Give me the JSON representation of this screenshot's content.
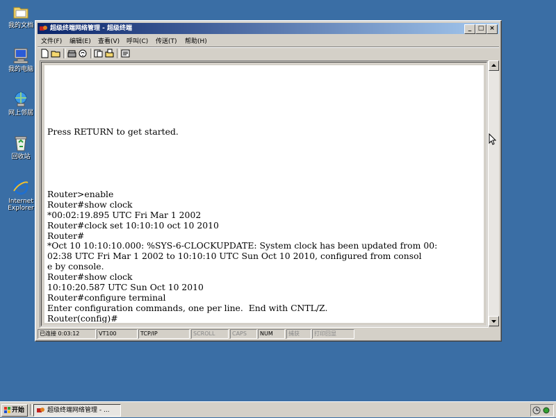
{
  "desktop": {
    "icons": [
      {
        "label": "我的文档"
      },
      {
        "label": "我的电脑"
      },
      {
        "label": "网上邻居"
      },
      {
        "label": "回收站"
      },
      {
        "label": "Internet Explorer"
      }
    ]
  },
  "window": {
    "title": "超级终端网络管理 - 超级终端",
    "controls": {
      "minimize": "_",
      "maximize": "□",
      "close": "×"
    }
  },
  "menubar": {
    "items": [
      "文件(F)",
      "编辑(E)",
      "查看(V)",
      "呼叫(C)",
      "传送(T)",
      "帮助(H)"
    ]
  },
  "toolbar": {
    "icons": [
      "new-icon",
      "open-icon",
      "phone-icon",
      "properties-icon",
      "disconnect-icon",
      "send-icon",
      "receive-icon",
      "settings-icon"
    ]
  },
  "terminal": {
    "text": "\n\n\n\n\n\nPress RETURN to get started.\n\n\n\n\n\nRouter>enable\nRouter#show clock\n*00:02:19.895 UTC Fri Mar 1 2002\nRouter#clock set 10:10:10 oct 10 2010\nRouter#\n*Oct 10 10:10:10.000: %SYS-6-CLOCKUPDATE: System clock has been updated from 00:\n02:38 UTC Fri Mar 1 2002 to 10:10:10 UTC Sun Oct 10 2010, configured from consol\ne by console.\nRouter#show clock\n10:10:20.587 UTC Sun Oct 10 2010\nRouter#configure terminal\nEnter configuration commands, one per line.  End with CNTL/Z.\nRouter(config)#"
  },
  "statusbar": {
    "connected": "已连接 0:03:12",
    "emulation": "VT100",
    "protocol": "TCP/IP",
    "scroll": "SCROLL",
    "caps": "CAPS",
    "num": "NUM",
    "capture": "捕获",
    "print_echo": "打印回显"
  },
  "taskbar": {
    "start_label": "开始",
    "task_label": "超级终端网络管理 - ..."
  },
  "colors": {
    "desktop": "#3a6ea5",
    "titlebar_start": "#0a246a",
    "titlebar_end": "#a6caf0",
    "chrome": "#d4d0c8"
  }
}
